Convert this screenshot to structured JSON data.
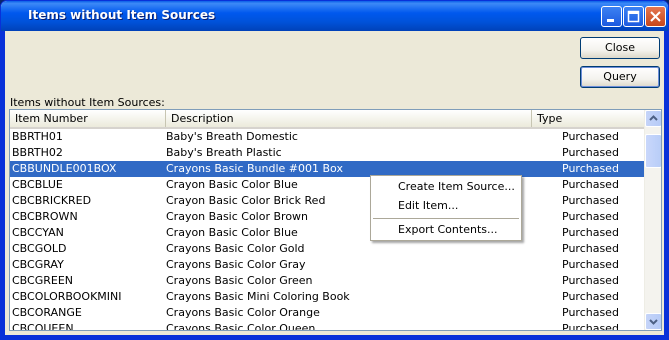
{
  "window": {
    "title": "Items without Item Sources",
    "controls": {
      "minimize": "minimize-icon",
      "maximize": "maximize-icon",
      "close": "close-icon"
    }
  },
  "buttons": {
    "close_label": "Close",
    "query_label": "Query"
  },
  "list": {
    "label": "Items without Item Sources:",
    "columns": [
      "Item Number",
      "Description",
      "Type"
    ],
    "rows": [
      {
        "number": "BBRTH01",
        "description": "Baby's Breath Domestic",
        "type": "Purchased"
      },
      {
        "number": "BBRTH02",
        "description": "Baby's Breath Plastic",
        "type": "Purchased"
      },
      {
        "number": "CBBUNDLE001BOX",
        "description": "Crayons Basic Bundle #001 Box",
        "type": "Purchased"
      },
      {
        "number": "CBCBLUE",
        "description": "Crayon Basic Color Blue",
        "type": "Purchased"
      },
      {
        "number": "CBCBRICKRED",
        "description": "Crayon Basic Color Brick Red",
        "type": "Purchased"
      },
      {
        "number": "CBCBROWN",
        "description": "Crayon Basic Color Brown",
        "type": "Purchased"
      },
      {
        "number": "CBCCYAN",
        "description": "Crayon Basic Color Blue",
        "type": "Purchased"
      },
      {
        "number": "CBCGOLD",
        "description": "Crayons Basic Color Gold",
        "type": "Purchased"
      },
      {
        "number": "CBCGRAY",
        "description": "Crayons Basic Color Gray",
        "type": "Purchased"
      },
      {
        "number": "CBCGREEN",
        "description": "Crayons Basic Color Green",
        "type": "Purchased"
      },
      {
        "number": "CBCOLORBOOKMINI",
        "description": "Crayons Basic Mini Coloring Book",
        "type": "Purchased"
      },
      {
        "number": "CBCORANGE",
        "description": "Crayons Basic Color Orange",
        "type": "Purchased"
      },
      {
        "number": "CBCQUEEN",
        "description": "Crayons Basic Color Queen",
        "type": "Purchased"
      }
    ],
    "selected_index": 2
  },
  "context_menu": {
    "items": [
      "Create Item Source...",
      "Edit Item...",
      "Export Contents..."
    ]
  },
  "colors": {
    "titlebar": "#0054e3",
    "selection": "#316ac5",
    "window_bg": "#ece9d8"
  }
}
